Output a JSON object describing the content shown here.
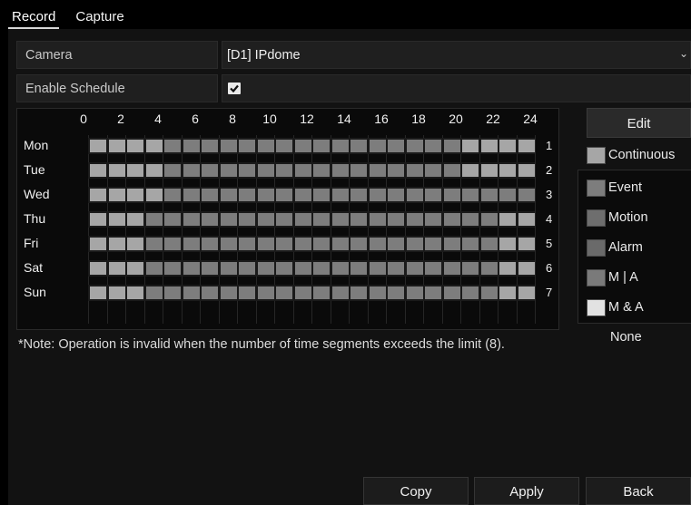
{
  "tabs": [
    {
      "label": "Record",
      "active": true
    },
    {
      "label": "Capture",
      "active": false
    }
  ],
  "form": {
    "camera_label": "Camera",
    "camera_value": "[D1] IPdome",
    "enable_schedule_label": "Enable Schedule",
    "enable_schedule_checked": true
  },
  "schedule": {
    "hour_labels": [
      "0",
      "2",
      "4",
      "6",
      "8",
      "10",
      "12",
      "14",
      "16",
      "18",
      "20",
      "22",
      "24"
    ],
    "days": [
      {
        "label": "Mon",
        "num": "1",
        "segments": [
          {
            "start": 0,
            "end": 4,
            "type": "continuous"
          },
          {
            "start": 4,
            "end": 20,
            "type": "event"
          },
          {
            "start": 20,
            "end": 24,
            "type": "continuous"
          }
        ]
      },
      {
        "label": "Tue",
        "num": "2",
        "segments": [
          {
            "start": 0,
            "end": 4,
            "type": "continuous"
          },
          {
            "start": 4,
            "end": 20,
            "type": "event"
          },
          {
            "start": 20,
            "end": 24,
            "type": "continuous"
          }
        ]
      },
      {
        "label": "Wed",
        "num": "3",
        "segments": [
          {
            "start": 0,
            "end": 4,
            "type": "continuous"
          },
          {
            "start": 4,
            "end": 24,
            "type": "event"
          }
        ]
      },
      {
        "label": "Thu",
        "num": "4",
        "segments": [
          {
            "start": 0,
            "end": 3,
            "type": "continuous"
          },
          {
            "start": 3,
            "end": 22,
            "type": "event"
          },
          {
            "start": 22,
            "end": 24,
            "type": "continuous"
          }
        ]
      },
      {
        "label": "Fri",
        "num": "5",
        "segments": [
          {
            "start": 0,
            "end": 3,
            "type": "continuous"
          },
          {
            "start": 3,
            "end": 22,
            "type": "event"
          },
          {
            "start": 22,
            "end": 24,
            "type": "continuous"
          }
        ]
      },
      {
        "label": "Sat",
        "num": "6",
        "segments": [
          {
            "start": 0,
            "end": 3,
            "type": "continuous"
          },
          {
            "start": 3,
            "end": 22,
            "type": "event"
          },
          {
            "start": 22,
            "end": 24,
            "type": "continuous"
          }
        ]
      },
      {
        "label": "Sun",
        "num": "7",
        "segments": [
          {
            "start": 0,
            "end": 3,
            "type": "continuous"
          },
          {
            "start": 3,
            "end": 22,
            "type": "event"
          },
          {
            "start": 22,
            "end": 24,
            "type": "continuous"
          }
        ]
      }
    ]
  },
  "sidebar": {
    "edit_label": "Edit",
    "legend": [
      {
        "label": "Continuous",
        "color": "#a6a6a6"
      },
      {
        "label": "Event",
        "color": "#7d7d7d"
      },
      {
        "label": "Motion",
        "color": "#6e6e6e"
      },
      {
        "label": "Alarm",
        "color": "#6a6a6a"
      },
      {
        "label": "M | A",
        "color": "#7a7a7a"
      },
      {
        "label": "M & A",
        "color": "#e2e2e2"
      }
    ],
    "none_label": "None"
  },
  "note": "*Note: Operation is invalid when the number of time segments exceeds the limit (8).",
  "buttons": {
    "copy": "Copy",
    "apply": "Apply",
    "back": "Back"
  },
  "colors": {
    "continuous": "#a6a6a6",
    "event": "#7d7d7d"
  },
  "icons": {
    "checkbox": "checkmark-icon",
    "dropdown": "chevron-down-icon"
  }
}
